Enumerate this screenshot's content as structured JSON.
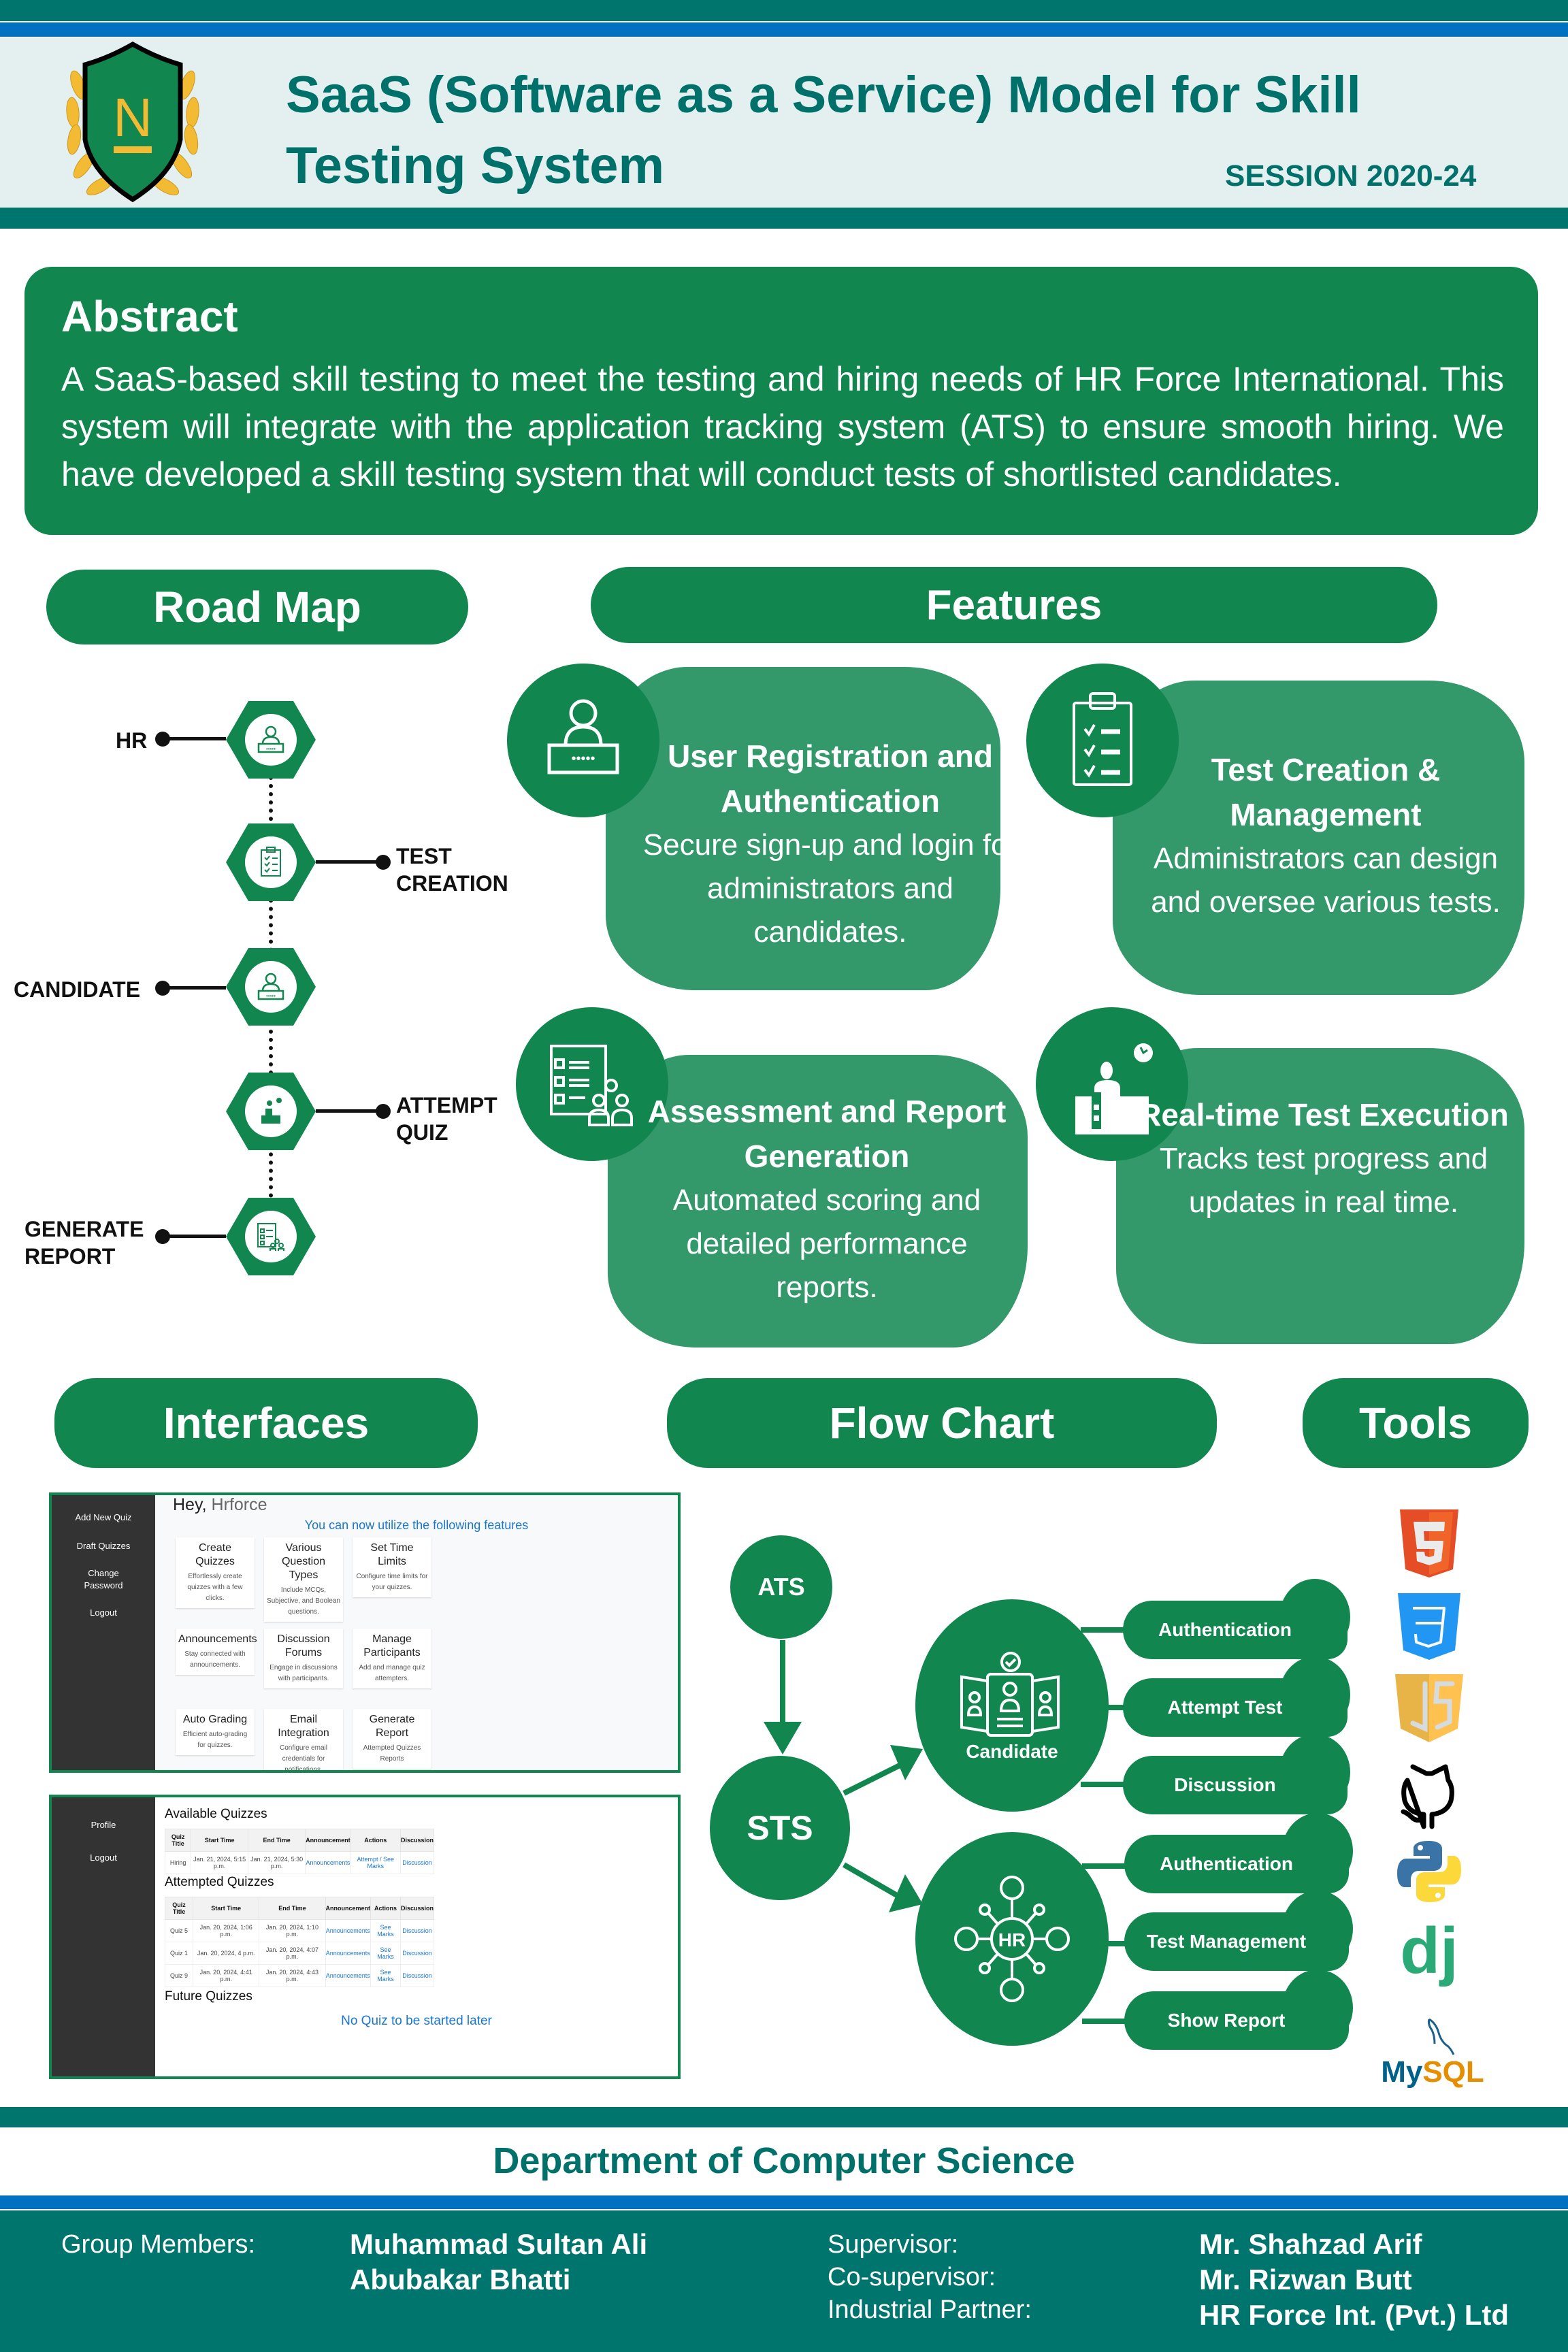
{
  "header": {
    "title": "SaaS (Software as a Service) Model for Skill Testing System",
    "session": "SESSION 2020-24",
    "logo_letter": "N"
  },
  "colors": {
    "primary_green": "#11864f",
    "light_green": "#33996b",
    "teal": "#00756d",
    "blue": "#0071c1",
    "header_band": "#e4f0f0",
    "gold": "#f3bb33"
  },
  "abstract": {
    "heading": "Abstract",
    "text": "A SaaS-based skill testing to meet the testing and hiring needs of HR Force International. This system will integrate with the application tracking system (ATS) to ensure smooth hiring. We have developed a skill testing system that will conduct tests of shortlisted candidates."
  },
  "roadmap": {
    "heading": "Road Map",
    "steps": [
      {
        "label": "HR",
        "side": "left",
        "icon": "user-login-icon"
      },
      {
        "label": "TEST CREATION",
        "side": "right",
        "icon": "clipboard-checklist-icon"
      },
      {
        "label": "CANDIDATE",
        "side": "left",
        "icon": "user-login-icon"
      },
      {
        "label": "ATTEMPT QUIZ",
        "side": "right",
        "icon": "person-at-desk-icon"
      },
      {
        "label": "GENERATE REPORT",
        "side": "left",
        "icon": "report-group-icon"
      }
    ]
  },
  "features": {
    "heading": "Features",
    "items": [
      {
        "title": "User Registration and Authentication",
        "description": "Secure sign-up and login for administrators and candidates.",
        "icon": "user-login-icon"
      },
      {
        "title": "Test Creation & Management",
        "description": "Administrators can design and oversee various tests.",
        "icon": "clipboard-checklist-icon"
      },
      {
        "title": "Assessment and Report Generation",
        "description": "Automated scoring and detailed performance reports.",
        "icon": "report-group-icon"
      },
      {
        "title": "Real-time Test Execution",
        "description": "Tracks test progress and updates in real time.",
        "icon": "person-at-desk-icon"
      }
    ]
  },
  "interfaces": {
    "heading": "Interfaces",
    "screen1": {
      "sidebar": [
        "Add New Quiz",
        "Draft Quizzes",
        "Change Password",
        "Logout"
      ],
      "greeting": "Hey,",
      "username": "Hrforce",
      "subtitle": "You can now utilize the following features",
      "cards": [
        {
          "title": "Create Quizzes",
          "desc": "Effortlessly create quizzes with a few clicks."
        },
        {
          "title": "Various Question Types",
          "desc": "Include MCQs, Subjective, and Boolean questions."
        },
        {
          "title": "Set Time Limits",
          "desc": "Configure time limits for your quizzes."
        },
        {
          "title": "Announcements",
          "desc": "Stay connected with announcements."
        },
        {
          "title": "Discussion Forums",
          "desc": "Engage in discussions with participants."
        },
        {
          "title": "Manage Participants",
          "desc": "Add and manage quiz attempters."
        },
        {
          "title": "Auto Grading",
          "desc": "Efficient auto-grading for quizzes."
        },
        {
          "title": "Email Integration",
          "desc": "Configure email credentials for notifications."
        },
        {
          "title": "Generate Report",
          "desc": "Attempted Quizzes Reports"
        }
      ]
    },
    "screen2": {
      "sidebar": [
        "Profile",
        "Logout"
      ],
      "available_title": "Available Quizzes",
      "attempted_title": "Attempted Quizzes",
      "future_title": "Future Quizzes",
      "no_future": "No Quiz to be started later",
      "columns": [
        "Quiz Title",
        "Start Time",
        "End Time",
        "Announcement",
        "Actions",
        "Discussion"
      ],
      "available_rows": [
        [
          "Hiring",
          "Jan. 21, 2024, 5:15 p.m.",
          "Jan. 21, 2024, 5:30 p.m.",
          "Announcements",
          "Attempt / See Marks",
          "Discussion"
        ]
      ],
      "attempted_rows": [
        [
          "Quiz 5",
          "Jan. 20, 2024, 1:06 p.m.",
          "Jan. 20, 2024, 1:10 p.m.",
          "Announcements",
          "See Marks",
          "Discussion"
        ],
        [
          "Quiz 1",
          "Jan. 20, 2024, 4 p.m.",
          "Jan. 20, 2024, 4:07 p.m.",
          "Announcements",
          "See Marks",
          "Discussion"
        ],
        [
          "Quiz 9",
          "Jan. 20, 2024, 4:41 p.m.",
          "Jan. 20, 2024, 4:43 p.m.",
          "Announcements",
          "See Marks",
          "Discussion"
        ]
      ]
    }
  },
  "flowchart": {
    "heading": "Flow Chart",
    "nodes": {
      "ats": "ATS",
      "sts": "STS",
      "candidate": "Candidate",
      "hr": "HR"
    },
    "candidate_actions": [
      "Authentication",
      "Attempt Test",
      "Discussion"
    ],
    "hr_actions": [
      "Authentication",
      "Test Management",
      "Show Report"
    ]
  },
  "tools": {
    "heading": "Tools",
    "items": [
      "HTML5",
      "CSS3",
      "JavaScript",
      "GitHub",
      "Python",
      "Django",
      "MySQL"
    ],
    "mysql_label_my": "My",
    "mysql_label_sql": "SQL",
    "django_label": "dj"
  },
  "footer": {
    "department": "Department of Computer Science",
    "group_label": "Group Members:",
    "members": [
      "Muhammad Sultan Ali",
      "Abubakar Bhatti"
    ],
    "roles": [
      "Supervisor:",
      "Co-supervisor:",
      "Industrial Partner:"
    ],
    "role_values": [
      "Mr. Shahzad Arif",
      "Mr. Rizwan Butt",
      "HR Force Int. (Pvt.) Ltd"
    ]
  }
}
